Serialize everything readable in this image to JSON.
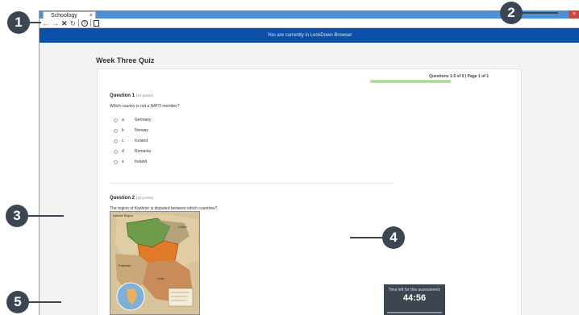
{
  "browser": {
    "tab_title": "Schoology",
    "tab_close": "×",
    "window_close": "×"
  },
  "toolbar": {
    "back": "←",
    "forward": "→",
    "stop": "✕",
    "reload": "↻",
    "info": "i"
  },
  "banner": {
    "text": "You are currently in LockDown Browser"
  },
  "quiz": {
    "title": "Week Three Quiz",
    "progress_label": "Questions 1-5 of 5  |  Page 1 of 1",
    "progress_fraction": 1.0,
    "questions": [
      {
        "title": "Question 1",
        "points": "(10 points)",
        "text": "Which country is not a NATO member?",
        "choices": [
          {
            "letter": "a",
            "label": "Germany"
          },
          {
            "letter": "b",
            "label": "Norway"
          },
          {
            "letter": "c",
            "label": "Iceland"
          },
          {
            "letter": "d",
            "label": "Romania"
          },
          {
            "letter": "e",
            "label": "Ireland"
          }
        ]
      },
      {
        "title": "Question 2",
        "points": "(10 points)",
        "text": "The region of Kashmir is disputed between which countries?"
      }
    ],
    "map": {
      "title": "Kashmir Region",
      "labels": [
        "China",
        "Pakistan",
        "India"
      ]
    }
  },
  "timer": {
    "label": "Time left for this assessment:",
    "value": "44:56"
  },
  "callouts": [
    "1",
    "2",
    "3",
    "4",
    "5"
  ]
}
